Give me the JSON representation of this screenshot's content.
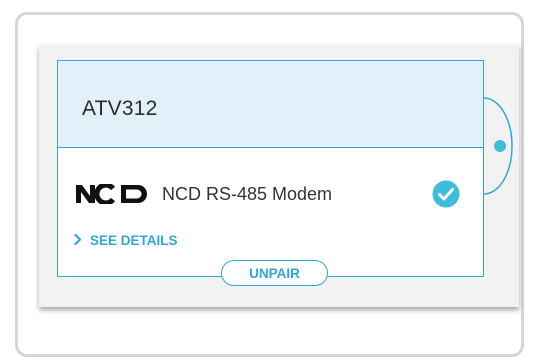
{
  "device": {
    "name": "ATV312"
  },
  "gateway": {
    "logo_text": "NCD",
    "name": "NCD RS-485 Modem",
    "status_icon": "check-circle-icon",
    "paired": true
  },
  "actions": {
    "see_details_label": "SEE DETAILS",
    "see_details_icon": "chevron-right-icon",
    "unpair_label": "UNPAIR"
  },
  "colors": {
    "accent": "#2fa8d5",
    "header_bg": "#e2f0f9",
    "check": "#3cbdd9",
    "panel_bg": "#f2f2f2",
    "text": "#2b2b2b"
  }
}
